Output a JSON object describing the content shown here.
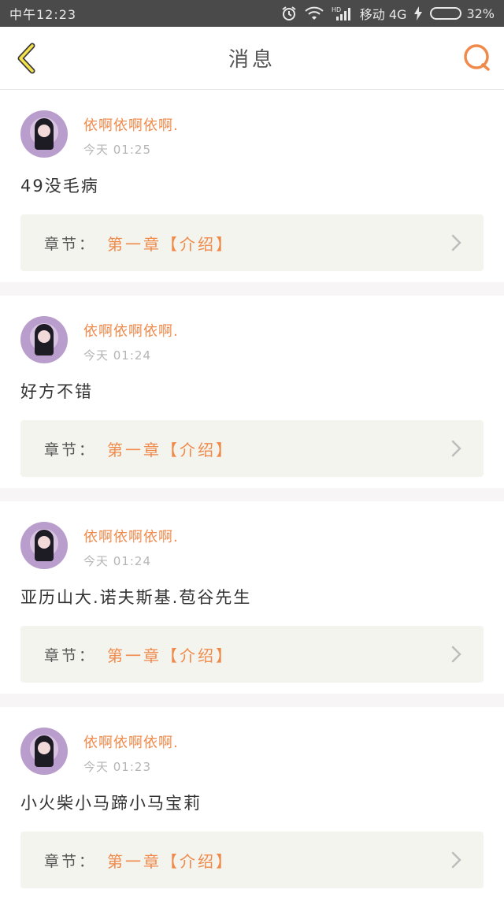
{
  "status": {
    "time": "中午12:23",
    "network_label": "移动 4G",
    "battery_text": "32%",
    "battery_level": 0.32,
    "battery_color": "#33c24b",
    "icons": [
      "alarm-icon",
      "wifi-icon",
      "hd-signal-icon",
      "charging-icon",
      "battery-icon"
    ]
  },
  "header": {
    "title": "消息",
    "back_icon": "chevron-left-icon",
    "search_icon": "search-icon",
    "accent": "#f08a4b"
  },
  "messages": [
    {
      "username": "依啊依啊依啊.",
      "time": "今天 01:25",
      "content": "49没毛病",
      "chapter_label": "章节：",
      "chapter_name": "第一章【介绍】"
    },
    {
      "username": "依啊依啊依啊.",
      "time": "今天 01:24",
      "content": "好方不错",
      "chapter_label": "章节：",
      "chapter_name": "第一章【介绍】"
    },
    {
      "username": "依啊依啊依啊.",
      "time": "今天 01:24",
      "content": "亚历山大.诺夫斯基.苞谷先生",
      "chapter_label": "章节：",
      "chapter_name": "第一章【介绍】"
    },
    {
      "username": "依啊依啊依啊.",
      "time": "今天 01:23",
      "content": "小火柴小马蹄小马宝莉",
      "chapter_label": "章节：",
      "chapter_name": "第一章【介绍】"
    }
  ]
}
